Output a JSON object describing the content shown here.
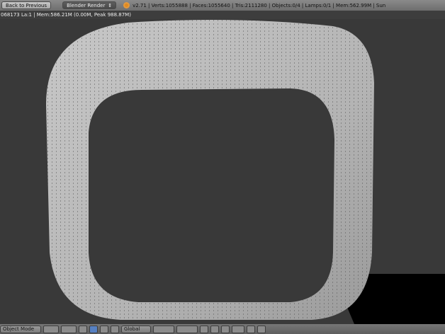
{
  "header": {
    "back_label": "Back to Previous",
    "render_engine": "Blender Render",
    "stats": "v2.71 | Verts:1055888 | Faces:1055640 | Tris:2111280 | Objects:0/4 | Lamps:0/1 | Mem:562.99M | Sun"
  },
  "info": {
    "text": "068173 La:1 | Mem:586.21M (0.00M, Peak 988.87M)"
  },
  "footer": {
    "mode": "Object Mode",
    "orientation": "Global"
  },
  "colors": {
    "viewport": "#393939",
    "mesh": "#bdbdbd"
  }
}
